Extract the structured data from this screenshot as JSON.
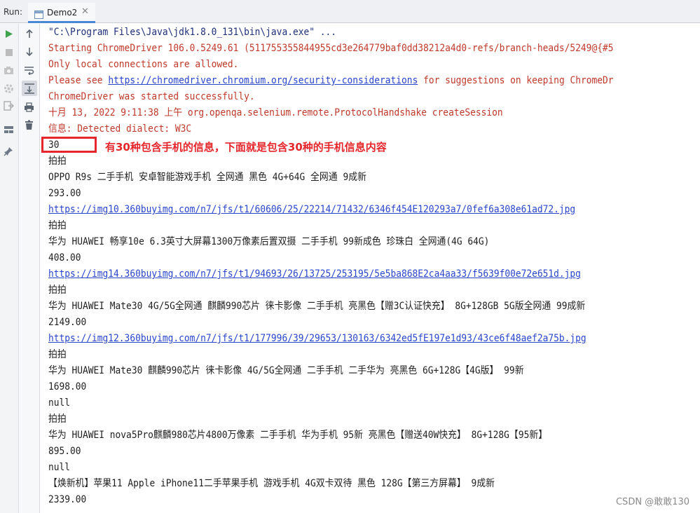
{
  "header": {
    "run_label": "Run:",
    "tab_label": "Demo2",
    "tab_close": "✕"
  },
  "console": {
    "lines": [
      "\"C:\\Program Files\\Java\\jdk1.8.0_131\\bin\\java.exe\" ...",
      "Starting ChromeDriver 106.0.5249.61 (511755355844955cd3e264779baf0dd38212a4d0-refs/branch-heads/5249@{#5",
      "Only local connections are allowed.",
      "Please see",
      "https://chromedriver.chromium.org/security-considerations",
      "for suggestions on keeping ChromeDr",
      "ChromeDriver was started successfully.",
      "十月 13, 2022 9:11:38 上午 org.openqa.selenium.remote.ProtocolHandshake createSession",
      "信息: Detected dialect: W3C",
      "30",
      "拍拍",
      "OPPO R9s 二手手机 安卓智能游戏手机 全网通 黑色 4G+64G 全网通 9成新",
      "293.00",
      "https://img10.360buyimg.com/n7/jfs/t1/60606/25/22214/71432/6346f454E120293a7/0fef6a308e61ad72.jpg",
      "拍拍",
      "华为 HUAWEI 畅享10e 6.3英寸大屏幕1300万像素后置双摄 二手手机 99新成色 珍珠白 全网通(4G 64G)",
      "408.00",
      "https://img14.360buyimg.com/n7/jfs/t1/94693/26/13725/253195/5e5ba868E2ca4aa33/f5639f00e72e651d.jpg",
      "拍拍",
      "华为 HUAWEI Mate30 4G/5G全网通 麒麟990芯片 徕卡影像 二手手机 亮黑色【赠3C认证快充】 8G+128GB 5G版全网通 99成新",
      "2149.00",
      "https://img12.360buyimg.com/n7/jfs/t1/177996/39/29653/130163/6342ed5fE197e1d93/43ce6f48aef2a75b.jpg",
      "拍拍",
      "华为 HUAWEI Mate30 麒麟990芯片 徕卡影像 4G/5G全网通 二手手机 二手华为 亮黑色 6G+128G【4G版】 99新",
      "1698.00",
      "null",
      "拍拍",
      "华为 HUAWEI nova5Pro麒麟980芯片4800万像素 二手手机 华为手机 95新 亮黑色【赠送40W快充】 8G+128G【95新】",
      "895.00",
      "null",
      "【焕新机】苹果11 Apple iPhone11二手苹果手机 游戏手机 4G双卡双待 黑色 128G【第三方屏幕】 9成新",
      "2339.00"
    ]
  },
  "annotation": {
    "text": "有30种包含手机的信息，下面就是包含30种的手机信息内容"
  },
  "watermark": "CSDN @敢敢130",
  "icons": {
    "toolbar1": [
      "run-icon",
      "stop-icon",
      "camera-icon",
      "settings-icon",
      "exit-icon",
      "layout-icon",
      "pin-icon"
    ],
    "toolbar2": [
      "arrow-up-icon",
      "arrow-down-icon",
      "soft-wrap-icon",
      "scroll-to-end-icon",
      "print-icon",
      "trash-icon"
    ]
  },
  "colors": {
    "stderr_red": "#c0392b",
    "link_blue": "#2945cc",
    "annotation_red": "#e5262b",
    "run_green": "#3fa34d",
    "tab_underline": "#4a87d4"
  }
}
